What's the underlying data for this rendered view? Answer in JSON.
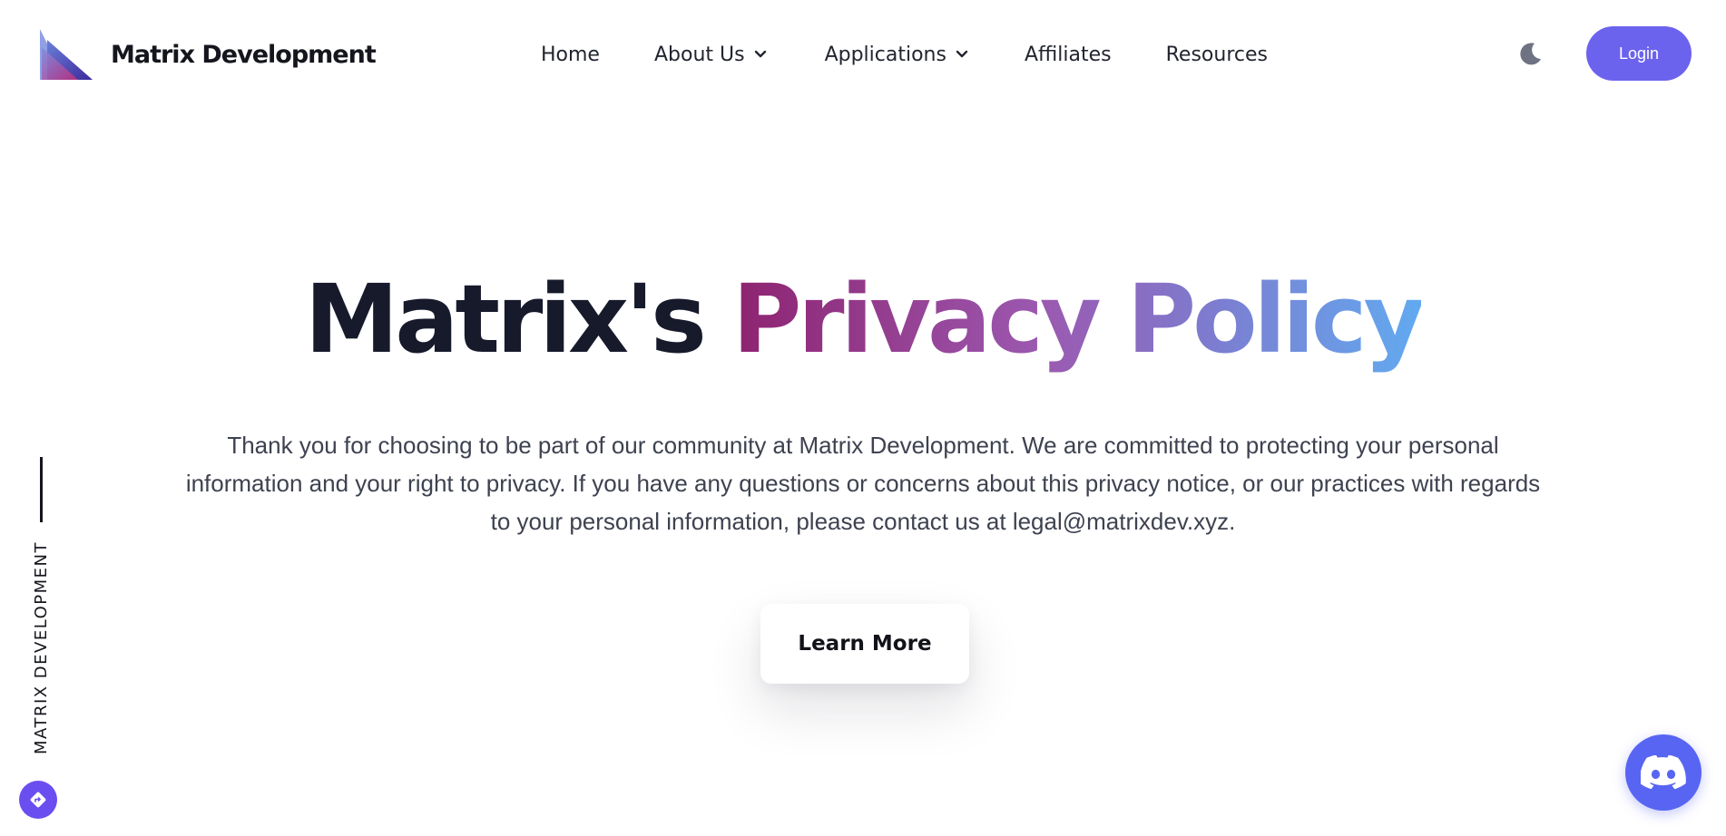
{
  "brand": {
    "name": "Matrix Development",
    "logo_icon": "matrix-triangle-logo"
  },
  "nav": {
    "items": [
      {
        "label": "Home",
        "has_dropdown": false
      },
      {
        "label": "About Us",
        "has_dropdown": true
      },
      {
        "label": "Applications",
        "has_dropdown": true
      },
      {
        "label": "Affiliates",
        "has_dropdown": false
      },
      {
        "label": "Resources",
        "has_dropdown": false
      }
    ],
    "theme_toggle_icon": "moon-icon",
    "login_label": "Login"
  },
  "hero": {
    "title_plain": "Matrix's",
    "title_highlight": "Privacy Policy",
    "intro": "Thank you for choosing to be part of our community at Matrix Development. We are committed to protecting your personal information and your right to privacy. If you have any questions or concerns about this privacy notice, or our practices with regards to your personal information, please contact us at legal@matrixdev.xyz.",
    "cta_label": "Learn More"
  },
  "side": {
    "label": "MATRIX DEVELOPMENT",
    "fab_icon": "diamond-arrow-icon"
  },
  "discord": {
    "icon": "discord-icon"
  },
  "colors": {
    "accent": "#6b63ee",
    "title_dark": "#161a2b",
    "gradient_start": "#8e2370",
    "gradient_mid": "#9b59b0",
    "gradient_end": "#62aaf0",
    "discord": "#5865f2",
    "body_text": "#3e4250"
  }
}
